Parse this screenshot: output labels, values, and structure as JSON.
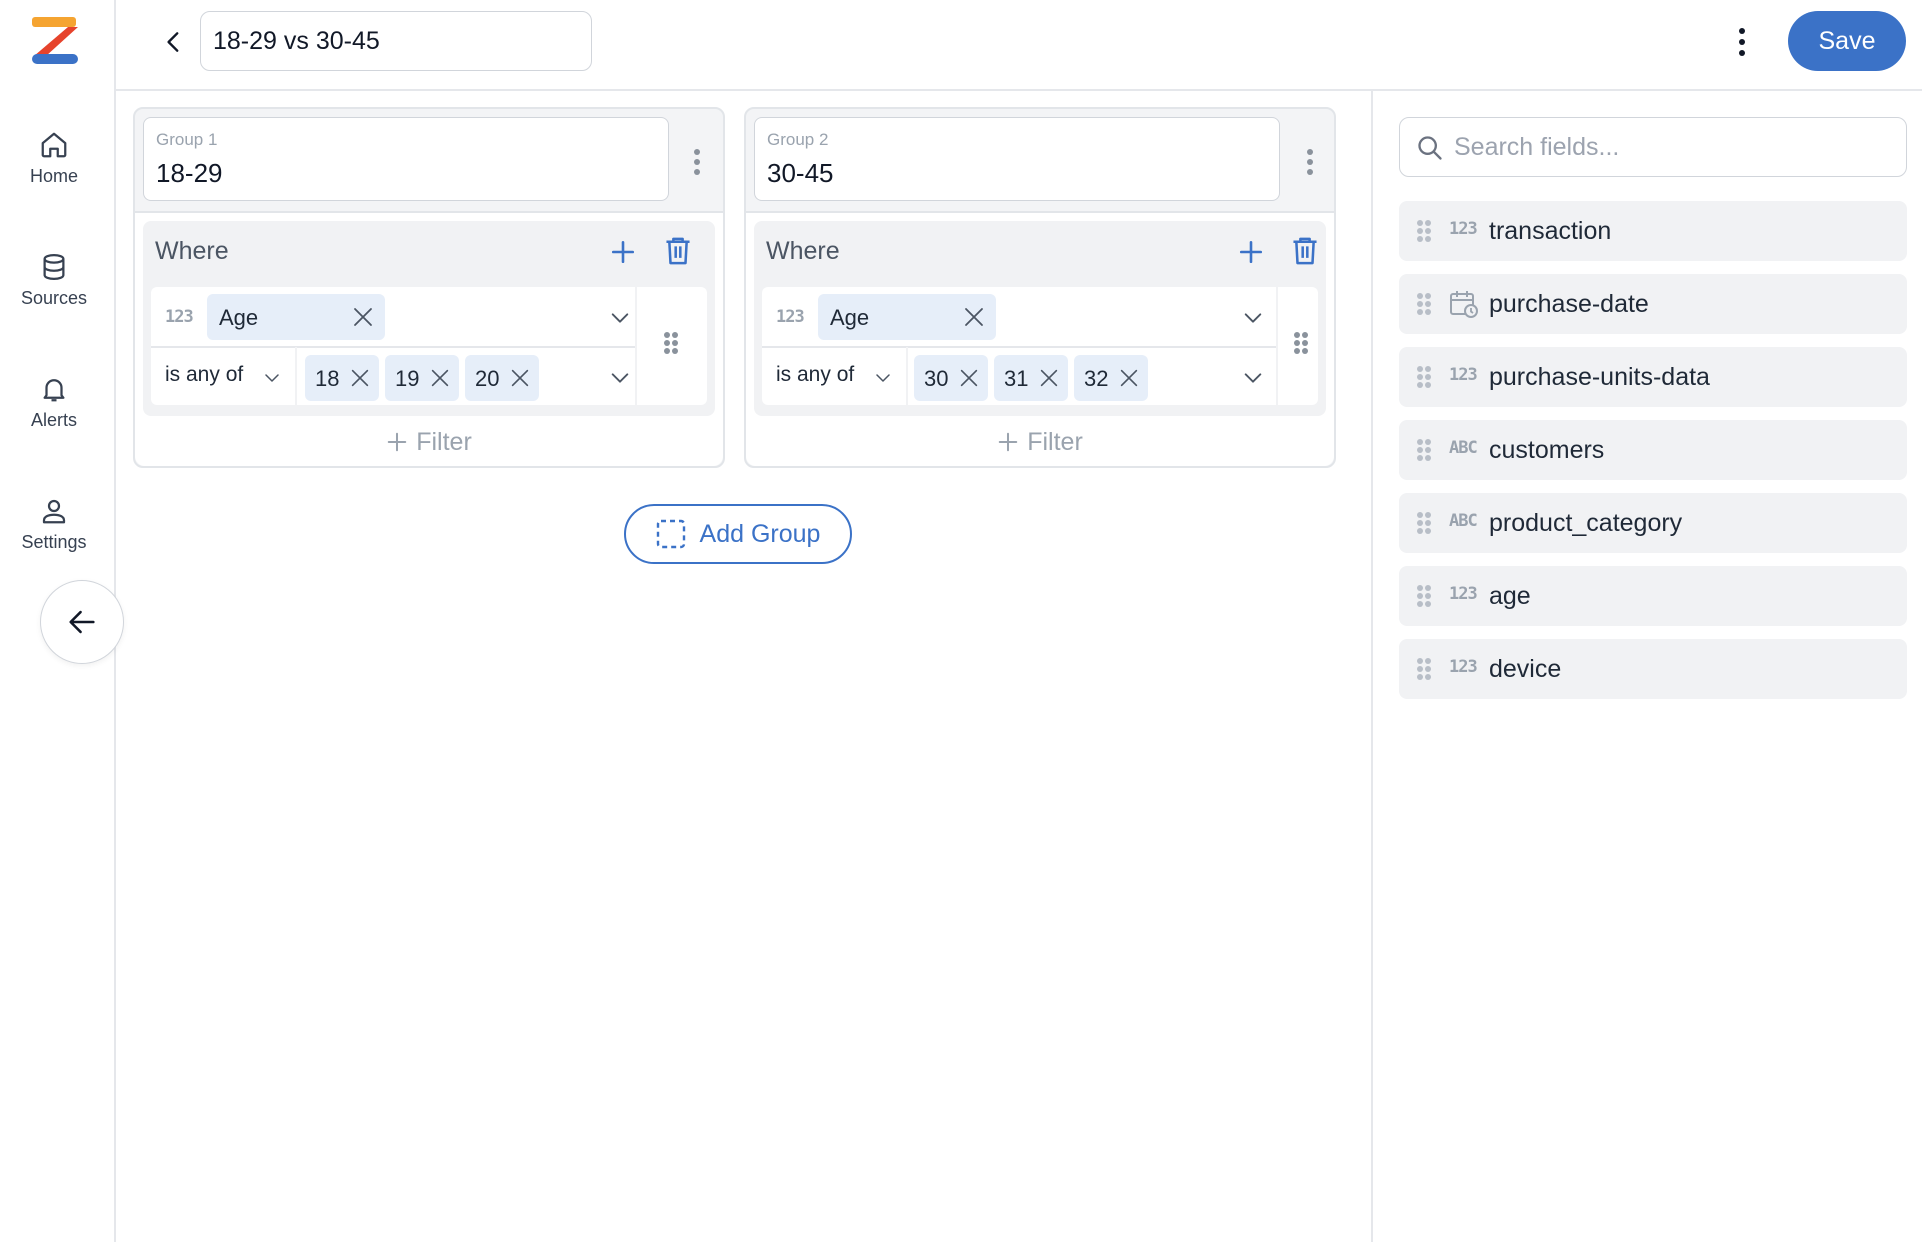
{
  "sidebar": {
    "items": [
      {
        "label": "Home",
        "icon": "home-icon"
      },
      {
        "label": "Sources",
        "icon": "database-icon"
      },
      {
        "label": "Alerts",
        "icon": "bell-icon"
      },
      {
        "label": "Settings",
        "icon": "user-icon"
      }
    ]
  },
  "header": {
    "title_value": "18-29 vs 30-45",
    "save_label": "Save"
  },
  "groups": [
    {
      "caption": "Group 1",
      "name": "18-29",
      "where_label": "Where",
      "condition": {
        "field_type": "123",
        "field": "Age",
        "operator": "is any of",
        "values": [
          "18",
          "19",
          "20"
        ]
      },
      "filter_label": "Filter"
    },
    {
      "caption": "Group 2",
      "name": "30-45",
      "where_label": "Where",
      "condition": {
        "field_type": "123",
        "field": "Age",
        "operator": "is any of",
        "values": [
          "30",
          "31",
          "32"
        ]
      },
      "filter_label": "Filter"
    }
  ],
  "add_group_label": "Add Group",
  "fields_panel": {
    "search_placeholder": "Search fields...",
    "fields": [
      {
        "type": "123",
        "name": "transaction"
      },
      {
        "type": "date",
        "name": "purchase-date"
      },
      {
        "type": "123",
        "name": "purchase-units-data"
      },
      {
        "type": "ABC",
        "name": "customers"
      },
      {
        "type": "ABC",
        "name": "product_category"
      },
      {
        "type": "123",
        "name": "age"
      },
      {
        "type": "123",
        "name": "device"
      }
    ]
  },
  "colors": {
    "accent": "#3b72c7",
    "chip_bg": "#e6eef9",
    "panel_bg": "#f1f2f4"
  }
}
